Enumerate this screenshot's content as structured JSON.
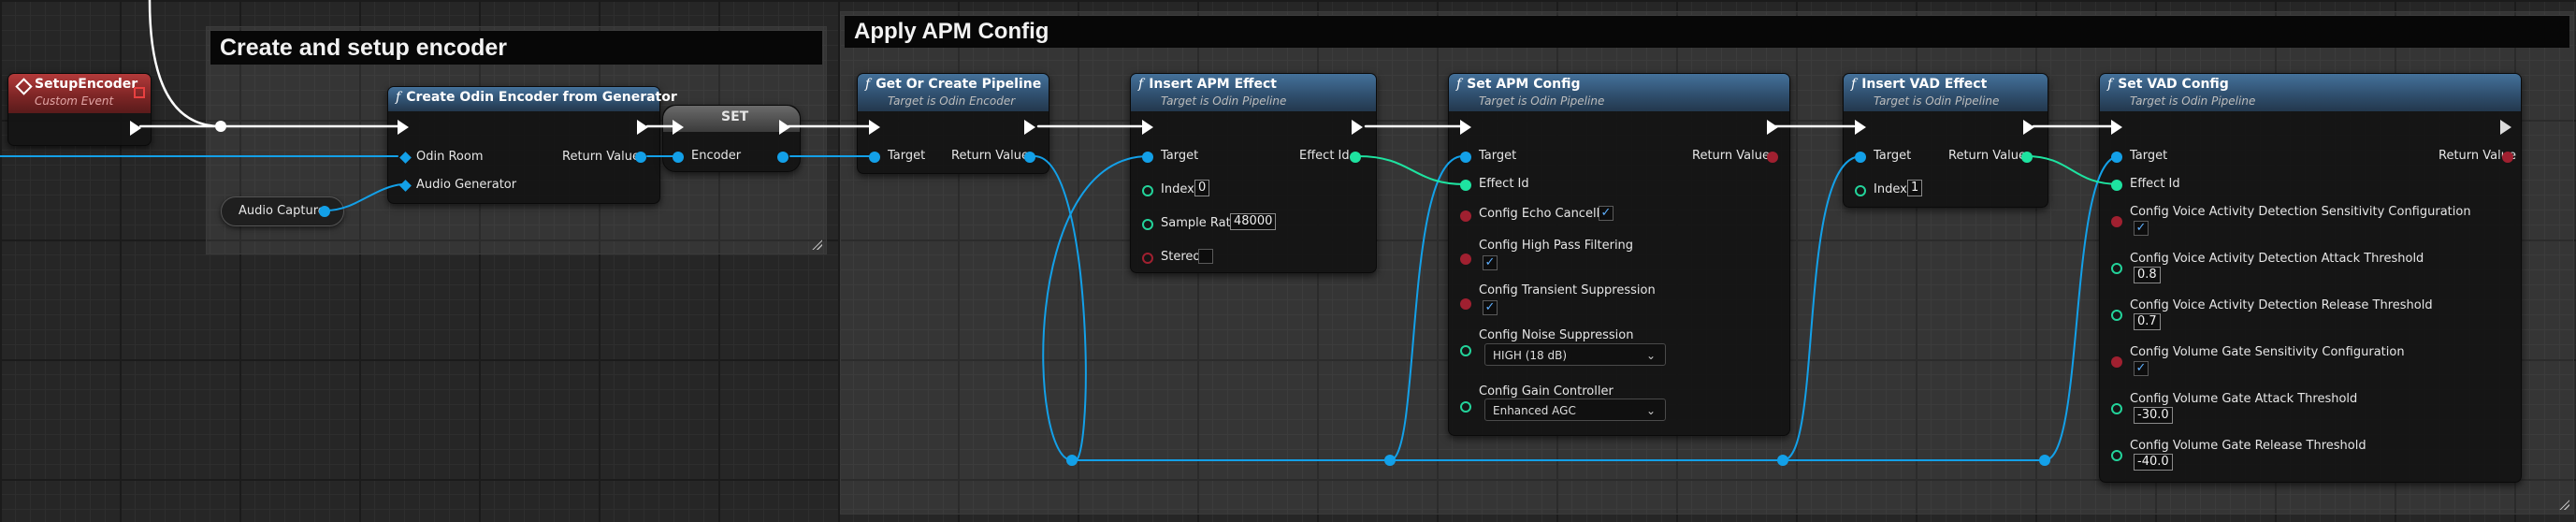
{
  "comments": {
    "encoder": "Create and setup encoder",
    "apm": "Apply APM Config"
  },
  "setup_event": {
    "title": "SetupEncoder",
    "subtitle": "Custom Event"
  },
  "create_encoder": {
    "title": "Create Odin Encoder from Generator",
    "in1": "Odin Room",
    "in2": "Audio Generator",
    "out": "Return Value"
  },
  "audio_capture": {
    "label": "Audio Capture"
  },
  "set_node": {
    "title": "SET",
    "pin": "Encoder"
  },
  "pipeline": {
    "title": "Get Or Create Pipeline",
    "subtitle": "Target is Odin Encoder",
    "in": "Target",
    "out": "Return Value"
  },
  "insert_apm": {
    "title": "Insert APM Effect",
    "subtitle": "Target is Odin Pipeline",
    "target": "Target",
    "out": "Effect Id",
    "index_label": "Index",
    "index_value": "0",
    "rate_label": "Sample Rate",
    "rate_value": "48000",
    "stereo_label": "Stereo"
  },
  "set_apm": {
    "title": "Set APM Config",
    "subtitle": "Target is Odin Pipeline",
    "target": "Target",
    "effect": "Effect Id",
    "out": "Return Value",
    "echo": "Config Echo Canceller",
    "hpf": "Config High Pass Filtering",
    "transient": "Config Transient Suppression",
    "noise": "Config Noise Suppression",
    "noise_value": "HIGH (18 dB)",
    "gain": "Config Gain Controller",
    "gain_value": "Enhanced AGC"
  },
  "insert_vad": {
    "title": "Insert VAD Effect",
    "subtitle": "Target is Odin Pipeline",
    "target": "Target",
    "out": "Return Value",
    "index_label": "Index",
    "index_value": "1"
  },
  "set_vad": {
    "title": "Set VAD Config",
    "subtitle": "Target is Odin Pipeline",
    "target": "Target",
    "effect": "Effect Id",
    "out": "Return Value",
    "sens": "Config Voice Activity Detection Sensitivity Configuration",
    "attack": "Config Voice Activity Detection Attack Threshold",
    "attack_value": "0.8",
    "release": "Config Voice Activity Detection Release Threshold",
    "release_value": "0.7",
    "gate_sens": "Config Volume Gate Sensitivity Configuration",
    "gate_attack": "Config Volume Gate Attack Threshold",
    "gate_attack_value": "-30.0",
    "gate_release": "Config Volume Gate Release Threshold",
    "gate_release_value": "-40.0"
  },
  "check_mark": "✓",
  "chevron": "⌄",
  "colors": {
    "exec": "#ffffff",
    "object_pin": "#13a0e8",
    "int_pin": "#1ee3a0",
    "bool_pin": "#a02030",
    "header_blue": "#30506f",
    "header_red": "#7e2626"
  }
}
